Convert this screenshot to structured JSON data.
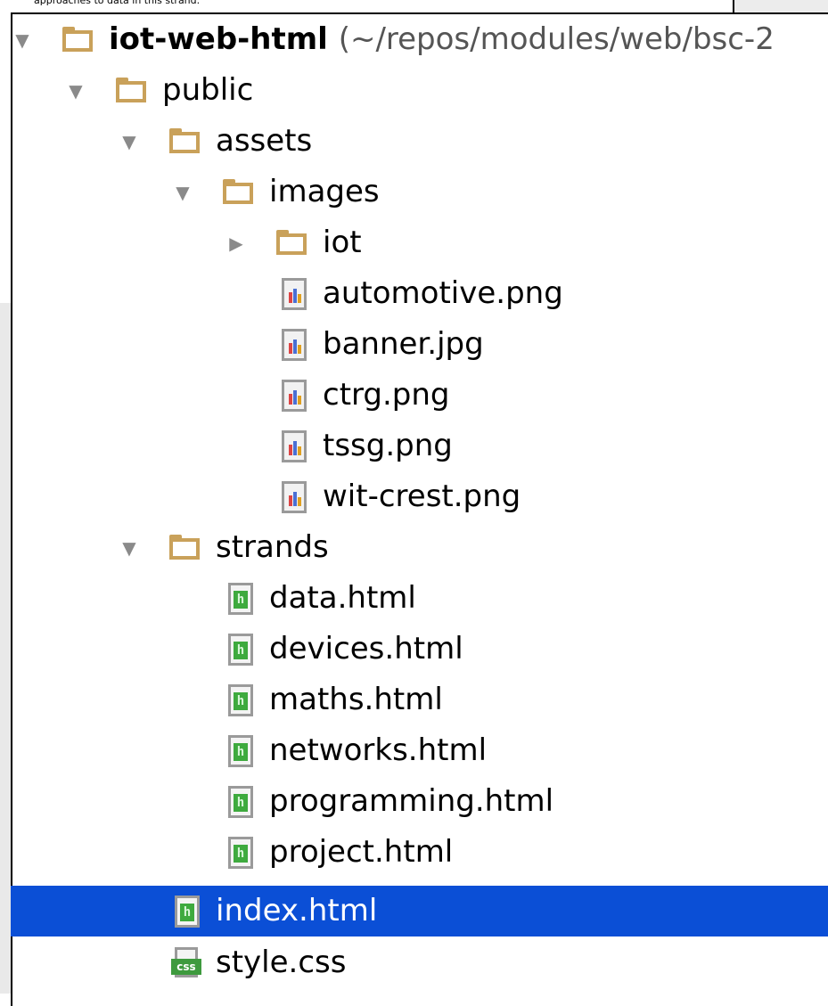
{
  "background_caption": "approaches to data in this strand.",
  "tree": {
    "root": {
      "name": "iot-web-html",
      "path": "(~/repos/modules/web/bsc-2"
    },
    "public": "public",
    "assets": "assets",
    "images": "images",
    "iot": "iot",
    "image_files": [
      "automotive.png",
      "banner.jpg",
      "ctrg.png",
      "tssg.png",
      "wit-crest.png"
    ],
    "strands": "strands",
    "strand_files": [
      "data.html",
      "devices.html",
      "maths.html",
      "networks.html",
      "programming.html",
      "project.html"
    ],
    "index": "index.html",
    "style": "style.css"
  },
  "selected_item": "index.html",
  "colors": {
    "selection": "#0b4fd6",
    "folder": "#c9a15a",
    "html_icon": "#3eaa3e",
    "arrow": "#8a8a8a"
  },
  "icons": {
    "expanded": "triangle-down-icon",
    "collapsed": "triangle-right-icon",
    "folder": "folder-icon",
    "image": "image-file-icon",
    "html": "html-file-icon",
    "css": "css-file-icon"
  }
}
